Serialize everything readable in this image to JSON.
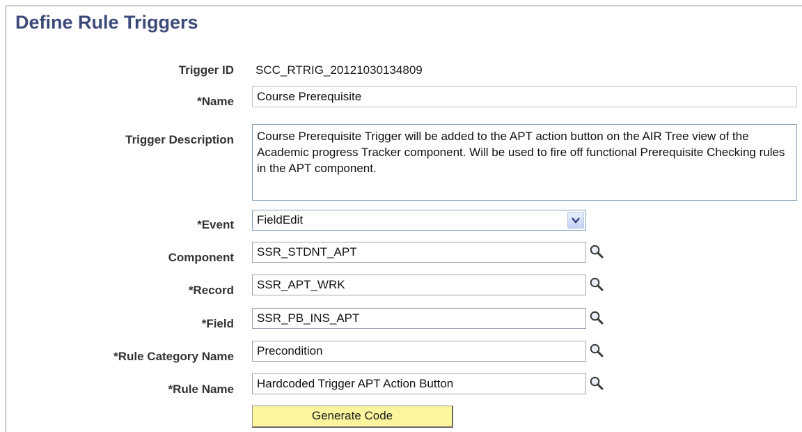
{
  "page": {
    "title": "Define Rule Triggers"
  },
  "fields": {
    "trigger_id": {
      "label": "Trigger ID",
      "value": "SCC_RTRIG_20121030134809"
    },
    "name": {
      "label": "*Name",
      "value": "Course Prerequisite"
    },
    "description": {
      "label": "Trigger Description",
      "value": "Course Prerequisite Trigger will be added to the APT action button on the AIR Tree view of the Academic progress Tracker component.  Will be used to fire off functional Prerequisite Checking rules in the APT component."
    },
    "event": {
      "label": "*Event",
      "value": "FieldEdit"
    },
    "component": {
      "label": "Component",
      "value": "SSR_STDNT_APT"
    },
    "record": {
      "label": "*Record",
      "value": "SSR_APT_WRK"
    },
    "field": {
      "label": "*Field",
      "value": "SSR_PB_INS_APT"
    },
    "rule_category": {
      "label": "*Rule Category Name",
      "value": "Precondition"
    },
    "rule_name": {
      "label": "*Rule Name",
      "value": "Hardcoded Trigger APT Action Button"
    }
  },
  "actions": {
    "generate_code": "Generate Code"
  },
  "icons": {
    "lookup": "magnifier-icon",
    "dropdown": "chevron-down-icon"
  },
  "colors": {
    "title": "#3c4a7a",
    "button_bg": "#fbf59d",
    "input_border": "#7f9db9"
  }
}
